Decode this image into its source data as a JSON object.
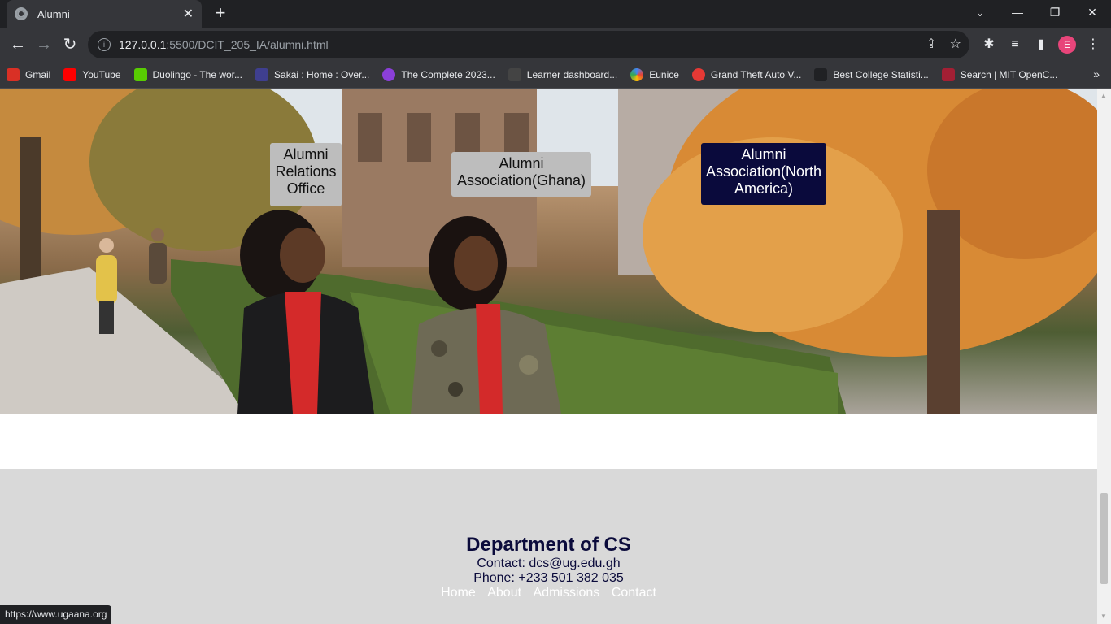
{
  "tab": {
    "title": "Alumni",
    "close": "✕",
    "new": "+"
  },
  "window": {
    "minimize": "—",
    "restore": "❐",
    "close": "✕",
    "tabsearch": "⌄"
  },
  "toolbar": {
    "back": "←",
    "forward": "→",
    "reload": "↻",
    "url_host": "127.0.0.1",
    "url_path": ":5500/DCIT_205_IA/alumni.html",
    "share": "⇪",
    "star": "☆",
    "extensions": "✱",
    "media": "≡",
    "sidepanel": "▮",
    "avatar": "E",
    "menu": "⋮"
  },
  "bookmarks": [
    {
      "label": "Gmail",
      "color": "#d93025"
    },
    {
      "label": "YouTube",
      "color": "#ff0000"
    },
    {
      "label": "Duolingo - The wor...",
      "color": "#58cc02"
    },
    {
      "label": "Sakai : Home : Over...",
      "color": "#3f3f8f"
    },
    {
      "label": "The Complete 2023...",
      "color": "#8b3fd9"
    },
    {
      "label": "Learner dashboard...",
      "color": "#444444"
    },
    {
      "label": "Eunice",
      "color": "#4285f4"
    },
    {
      "label": "Grand Theft Auto V...",
      "color": "#e53935"
    },
    {
      "label": "Best College Statisti...",
      "color": "#202124"
    },
    {
      "label": "Search | MIT OpenC...",
      "color": "#a31f34"
    }
  ],
  "bookmarks_more": "»",
  "nav": {
    "relations": "Alumni Relations Office",
    "ghana": "Alumni Association(Ghana)",
    "north_america": "Alumni Association(North America)"
  },
  "footer": {
    "heading": "Department of CS",
    "contact": "Contact: dcs@ug.edu.gh",
    "phone": "Phone: +233 501 382 035",
    "links": [
      "Home",
      "About",
      "Admissions",
      "Contact"
    ]
  },
  "status_url": "https://www.ugaana.org"
}
